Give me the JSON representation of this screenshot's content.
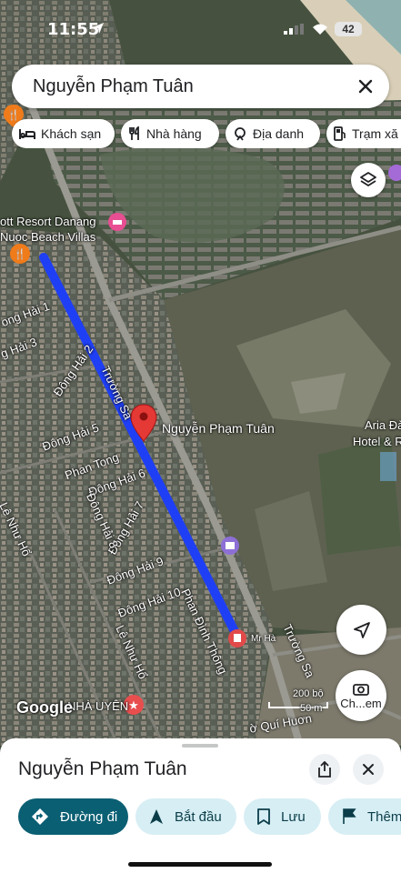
{
  "status_bar": {
    "time": "11:55",
    "battery": "42"
  },
  "search": {
    "query": "Nguyễn Phạm Tuân"
  },
  "chips": [
    {
      "label": "Khách sạn",
      "icon": "bed-icon"
    },
    {
      "label": "Nhà hàng",
      "icon": "restaurant-icon"
    },
    {
      "label": "Địa danh",
      "icon": "landmark-icon"
    },
    {
      "label": "Trạm xă",
      "icon": "gas-station-icon"
    }
  ],
  "map": {
    "labels": {
      "resort": "ott Resort Danang",
      "villas": "Nuoc Beach Villas",
      "pin_label": "Nguyễn Phạm Tuân",
      "aria1": "Aria Đà",
      "aria2": "Hotel & R",
      "truong_sa_1": "Trường Sa",
      "truong_sa_2": "Trường Sa",
      "dong_hai_1": "ong Hải 1",
      "dong_hai_2": "Đông Hải 2",
      "dong_hai_3": "g Hải 3",
      "dong_hai_5": "Đông Hải 5",
      "dong_hai_6": "Đông Hải 6",
      "dong_hai_7": "Đông Hải 7",
      "dong_hai_8": "Đông Hải 8",
      "dong_hai_9": "Đông Hải 9",
      "dong_hai_10": "Đông Hải 10",
      "phan_tong": "Phan Tong",
      "le_nhu_ho_1": "Lê Như Hổ",
      "le_nhu_ho_2": "Lê Như Hổ",
      "phan_dinh_thong": "Phan Đình Thông",
      "mr_ha": "Mr Hà",
      "nha_uyen": "NHÀ UYÊN",
      "qui_huon": "ờ Quí Huơn",
      "google": "Google",
      "scale_top": "200 bộ",
      "scale_bottom": "50 m"
    },
    "lens_label": "Ch...em"
  },
  "sheet": {
    "title": "Nguyễn Phạm Tuân",
    "actions": [
      {
        "label": "Đường đi",
        "icon": "directions-icon"
      },
      {
        "label": "Bắt đầu",
        "icon": "navigation-icon"
      },
      {
        "label": "Lưu",
        "icon": "bookmark-icon"
      },
      {
        "label": "Thêm",
        "icon": "flag-icon"
      }
    ]
  },
  "colors": {
    "route": "#1f3ff5",
    "pin": "#e53935",
    "primary_button": "#0b5f73",
    "secondary_button": "#d6eef4"
  }
}
